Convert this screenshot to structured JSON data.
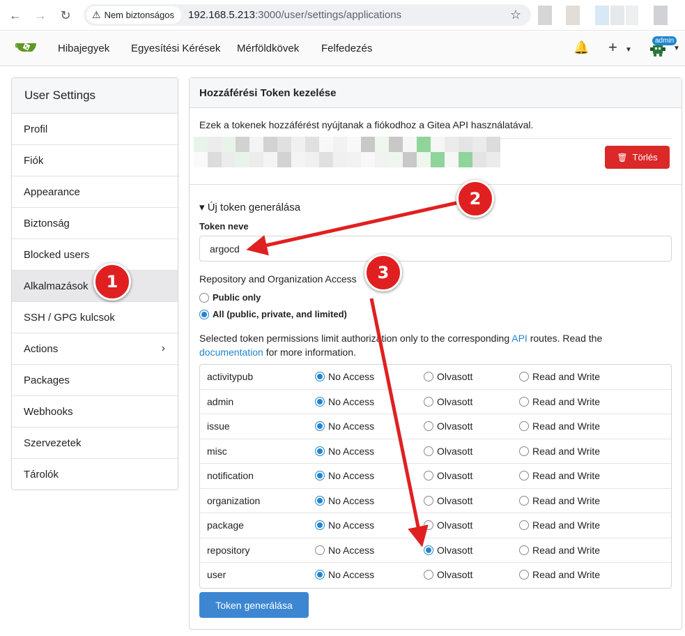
{
  "browser": {
    "security_label": "Nem biztonságos",
    "url_host": "192.168.5.213",
    "url_path": ":3000/user/settings/applications"
  },
  "nav": {
    "links": [
      "Hibajegyek",
      "Egyesítési Kérések",
      "Mérföldkövek",
      "Felfedezés"
    ],
    "admin_badge": "admin"
  },
  "sidebar": {
    "title": "User Settings",
    "items": [
      {
        "label": "Profil"
      },
      {
        "label": "Fiók"
      },
      {
        "label": "Appearance"
      },
      {
        "label": "Biztonság"
      },
      {
        "label": "Blocked users"
      },
      {
        "label": "Alkalmazások",
        "active": true
      },
      {
        "label": "SSH / GPG kulcsok"
      },
      {
        "label": "Actions"
      },
      {
        "label": "Packages"
      },
      {
        "label": "Webhooks"
      },
      {
        "label": "Szervezetek"
      },
      {
        "label": "Tárolók"
      }
    ]
  },
  "panel": {
    "title": "Hozzáférési Token kezelése",
    "description": "Ezek a tokenek hozzáférést nyújtanak a fiókodhoz a Gitea API használatával.",
    "delete_label": "Törlés",
    "new_token_summary": "▾ Új token generálása",
    "token_name_label": "Token neve",
    "token_name_value": "argocd",
    "repo_access_label": "Repository and Organization Access",
    "public_only_label": "Public only",
    "all_label": "All (public, private, and limited)",
    "perm_note_1": "Selected token permissions limit authorization only to the corresponding ",
    "perm_note_api": "API",
    "perm_note_2": " routes. Read the ",
    "perm_note_doc": "documentation",
    "perm_note_3": " for more information.",
    "option_labels": [
      "No Access",
      "Olvasott",
      "Read and Write"
    ],
    "permissions": [
      {
        "name": "activitypub",
        "selected": 0
      },
      {
        "name": "admin",
        "selected": 0
      },
      {
        "name": "issue",
        "selected": 0
      },
      {
        "name": "misc",
        "selected": 0
      },
      {
        "name": "notification",
        "selected": 0
      },
      {
        "name": "organization",
        "selected": 0
      },
      {
        "name": "package",
        "selected": 0
      },
      {
        "name": "repository",
        "selected": 1
      },
      {
        "name": "user",
        "selected": 0
      }
    ],
    "generate_label": "Token generálása"
  },
  "annotations": {
    "badges": [
      "1",
      "2",
      "3"
    ],
    "color": "#e02020"
  }
}
